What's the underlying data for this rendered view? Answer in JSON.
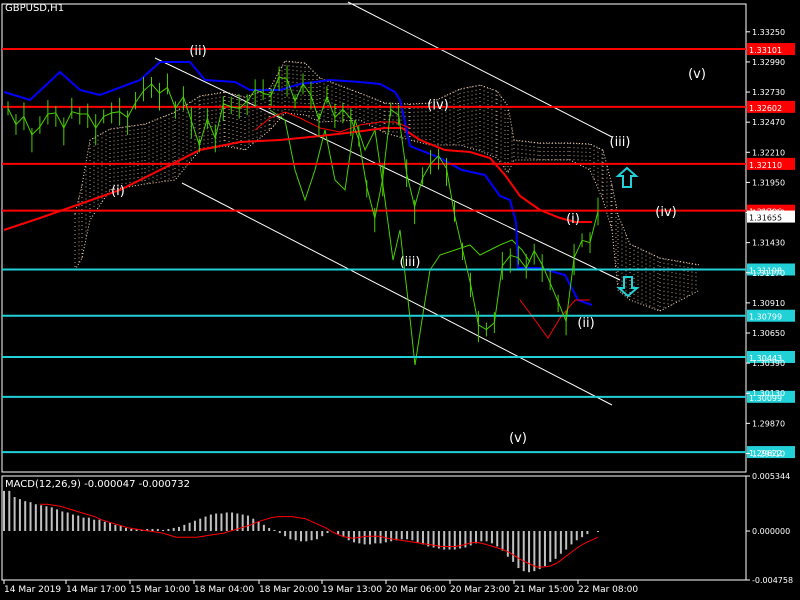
{
  "header": {
    "symbol": "GBPUSD,H1",
    "macd_title": "MACD(12,26,9) -0.000047 -0.000732"
  },
  "chart_data": {
    "type": "line",
    "symbol": "GBPUSD",
    "timeframe": "H1",
    "ylim": [
      1.2945,
      1.3349
    ],
    "y_ticks": [
      "1.33250",
      "1.32990",
      "1.32730",
      "1.32470",
      "1.32210",
      "1.31950",
      "1.31690",
      "1.31430",
      "1.31170",
      "1.30910",
      "1.30650",
      "1.30390",
      "1.30130",
      "1.29870",
      "1.29610"
    ],
    "x_ticks": [
      "14 Mar 2019",
      "14 Mar 17:00",
      "15 Mar 10:00",
      "18 Mar 04:00",
      "18 Mar 20:00",
      "19 Mar 13:00",
      "20 Mar 06:00",
      "20 Mar 23:00",
      "21 Mar 15:00",
      "22 Mar 08:00"
    ],
    "series": [
      {
        "values": [
          1.3259,
          1.3245,
          1.3252,
          1.3236,
          1.3243,
          1.3254,
          1.3255,
          1.3242,
          1.3256,
          1.3254,
          1.3254,
          1.3242,
          1.3252,
          1.3255,
          1.3256,
          1.3251,
          1.3264,
          1.3274,
          1.328,
          1.3272,
          1.3277,
          1.3259,
          1.3269,
          1.3248,
          1.3227,
          1.325,
          1.3233,
          1.3263,
          1.326,
          1.3259,
          1.3265,
          1.3275,
          1.3272,
          1.327,
          1.3286,
          1.3284,
          1.3265,
          1.328,
          1.327,
          1.3249,
          1.3269,
          1.3251,
          1.3258,
          1.325,
          1.3232,
          1.3191,
          1.3164,
          1.3198,
          1.3258,
          1.3253,
          1.3203,
          1.3174,
          1.3199,
          1.3211,
          1.3218,
          1.3207,
          1.3167,
          1.3137,
          1.3108,
          1.3072,
          1.3068,
          1.3074,
          1.3123,
          1.3132,
          1.313,
          1.3121,
          1.3136,
          1.3124,
          1.3108,
          1.3092,
          1.3075,
          1.313,
          1.3145,
          1.3143,
          1.317
        ],
        "color": "#47d000",
        "price_labels": []
      }
    ],
    "horizontal_levels": [
      {
        "value": 1.33101,
        "label": "1.33101",
        "color": "#ff0000"
      },
      {
        "value": 1.32602,
        "label": "1.32602",
        "color": "#ff0000"
      },
      {
        "value": 1.3211,
        "label": "1.32110",
        "color": "#ff0000"
      },
      {
        "value": 1.31706,
        "label": "1.31706",
        "color": "#ff0000"
      },
      {
        "value": 1.31198,
        "label": "1.31198",
        "color": "#22d0d8"
      },
      {
        "value": 1.30799,
        "label": "1.30799",
        "color": "#22d0d8"
      },
      {
        "value": 1.30443,
        "label": "1.30443",
        "color": "#22d0d8"
      },
      {
        "value": 1.30099,
        "label": "1.30099",
        "color": "#22d0d8"
      },
      {
        "value": 1.29622,
        "label": "1.29622",
        "color": "#22d0d8"
      }
    ],
    "current_price_label": "1.31655",
    "wave_labels": [
      "(i)",
      "(ii)",
      "(iii)",
      "(iv)",
      "(v)",
      "(i)",
      "(ii)",
      "(iii)",
      "(iv)",
      "(v)"
    ],
    "macd": {
      "ylim": [
        -0.004758,
        0.005344
      ],
      "y_ticks": [
        "0.005344",
        "0.000000",
        "-0.004758"
      ],
      "histogram": [
        3.9,
        3.9,
        3.3,
        3.1,
        2.9,
        2.8,
        2.6,
        2.5,
        2.4,
        2.3,
        2.1,
        1.9,
        1.8,
        1.6,
        1.5,
        1.3,
        1.3,
        1.1,
        1.1,
        0.9,
        0.8,
        0.6,
        0.5,
        0.3,
        0.2,
        0.2,
        0.1,
        0.2,
        0.2,
        0.2,
        0.1,
        0.2,
        0.3,
        0.4,
        0.6,
        0.8,
        1.0,
        1.2,
        1.4,
        1.6,
        1.7,
        1.7,
        1.8,
        1.8,
        1.7,
        1.6,
        1.5,
        1.2,
        0.9,
        0.6,
        0.3,
        0.1,
        -0.2,
        -0.5,
        -0.8,
        -0.9,
        -1.0,
        -1.0,
        -0.9,
        -0.8,
        -0.5,
        -0.2,
        0.0,
        -0.3,
        -0.6,
        -0.9,
        -1.1,
        -1.2,
        -1.3,
        -1.3,
        -1.2,
        -1.2,
        -1.1,
        -1.0,
        -0.9,
        -0.8,
        -0.8,
        -0.9,
        -1.1,
        -1.3,
        -1.5,
        -1.6,
        -1.7,
        -1.8,
        -1.8,
        -1.8,
        -1.7,
        -1.6,
        -1.4,
        -1.2,
        -1.0,
        -1.0,
        -1.2,
        -1.5,
        -1.9,
        -2.5,
        -3.0,
        -3.6,
        -3.9,
        -4.0,
        -3.9,
        -3.7,
        -3.4,
        -3.0,
        -2.7,
        -2.2,
        -1.8,
        -1.3,
        -0.9,
        -0.6,
        -0.3,
        0.0,
        -0.1
      ],
      "signal": [
        2.6,
        2.6,
        2.5,
        2.4,
        2.2,
        2.0,
        1.8,
        1.6,
        1.4,
        1.1,
        0.9,
        0.7,
        0.5,
        0.3,
        0.2,
        0.1,
        0.0,
        -0.1,
        -0.2,
        -0.4,
        -0.6,
        -0.6,
        -0.6,
        -0.6,
        -0.5,
        -0.4,
        -0.3,
        -0.2,
        0.0,
        0.2,
        0.4,
        0.6,
        0.9,
        1.1,
        1.3,
        1.4,
        1.4,
        1.4,
        1.3,
        1.2,
        0.9,
        0.6,
        0.3,
        -0.1,
        -0.4,
        -0.6,
        -0.7,
        -0.6,
        -0.5,
        -0.5,
        -0.5,
        -0.7,
        -0.8,
        -0.9,
        -1.0,
        -1.1,
        -1.2,
        -1.3,
        -1.4,
        -1.5,
        -1.5,
        -1.5,
        -1.4,
        -1.2,
        -1.1,
        -1.2,
        -1.4,
        -1.6,
        -1.8,
        -2.1,
        -2.5,
        -2.9,
        -3.2,
        -3.5,
        -3.5,
        -3.4,
        -3.1,
        -2.6,
        -2.1,
        -1.6,
        -1.2,
        -0.9,
        -0.6
      ],
      "colors": {
        "histogram": "#c0c0c0",
        "signal": "#ff0000"
      }
    }
  },
  "colors": {
    "background": "#000000",
    "price": "#47d000",
    "text": "#ffffff",
    "axis": "#ffffff",
    "resistance": "#ff0000",
    "support": "#22d0d8",
    "ma_red": "#ff0000",
    "ma_blue": "#0000ff",
    "cloud": "#ffdcb9",
    "channel": "#ffffff",
    "arrow": "#22d0d8"
  }
}
